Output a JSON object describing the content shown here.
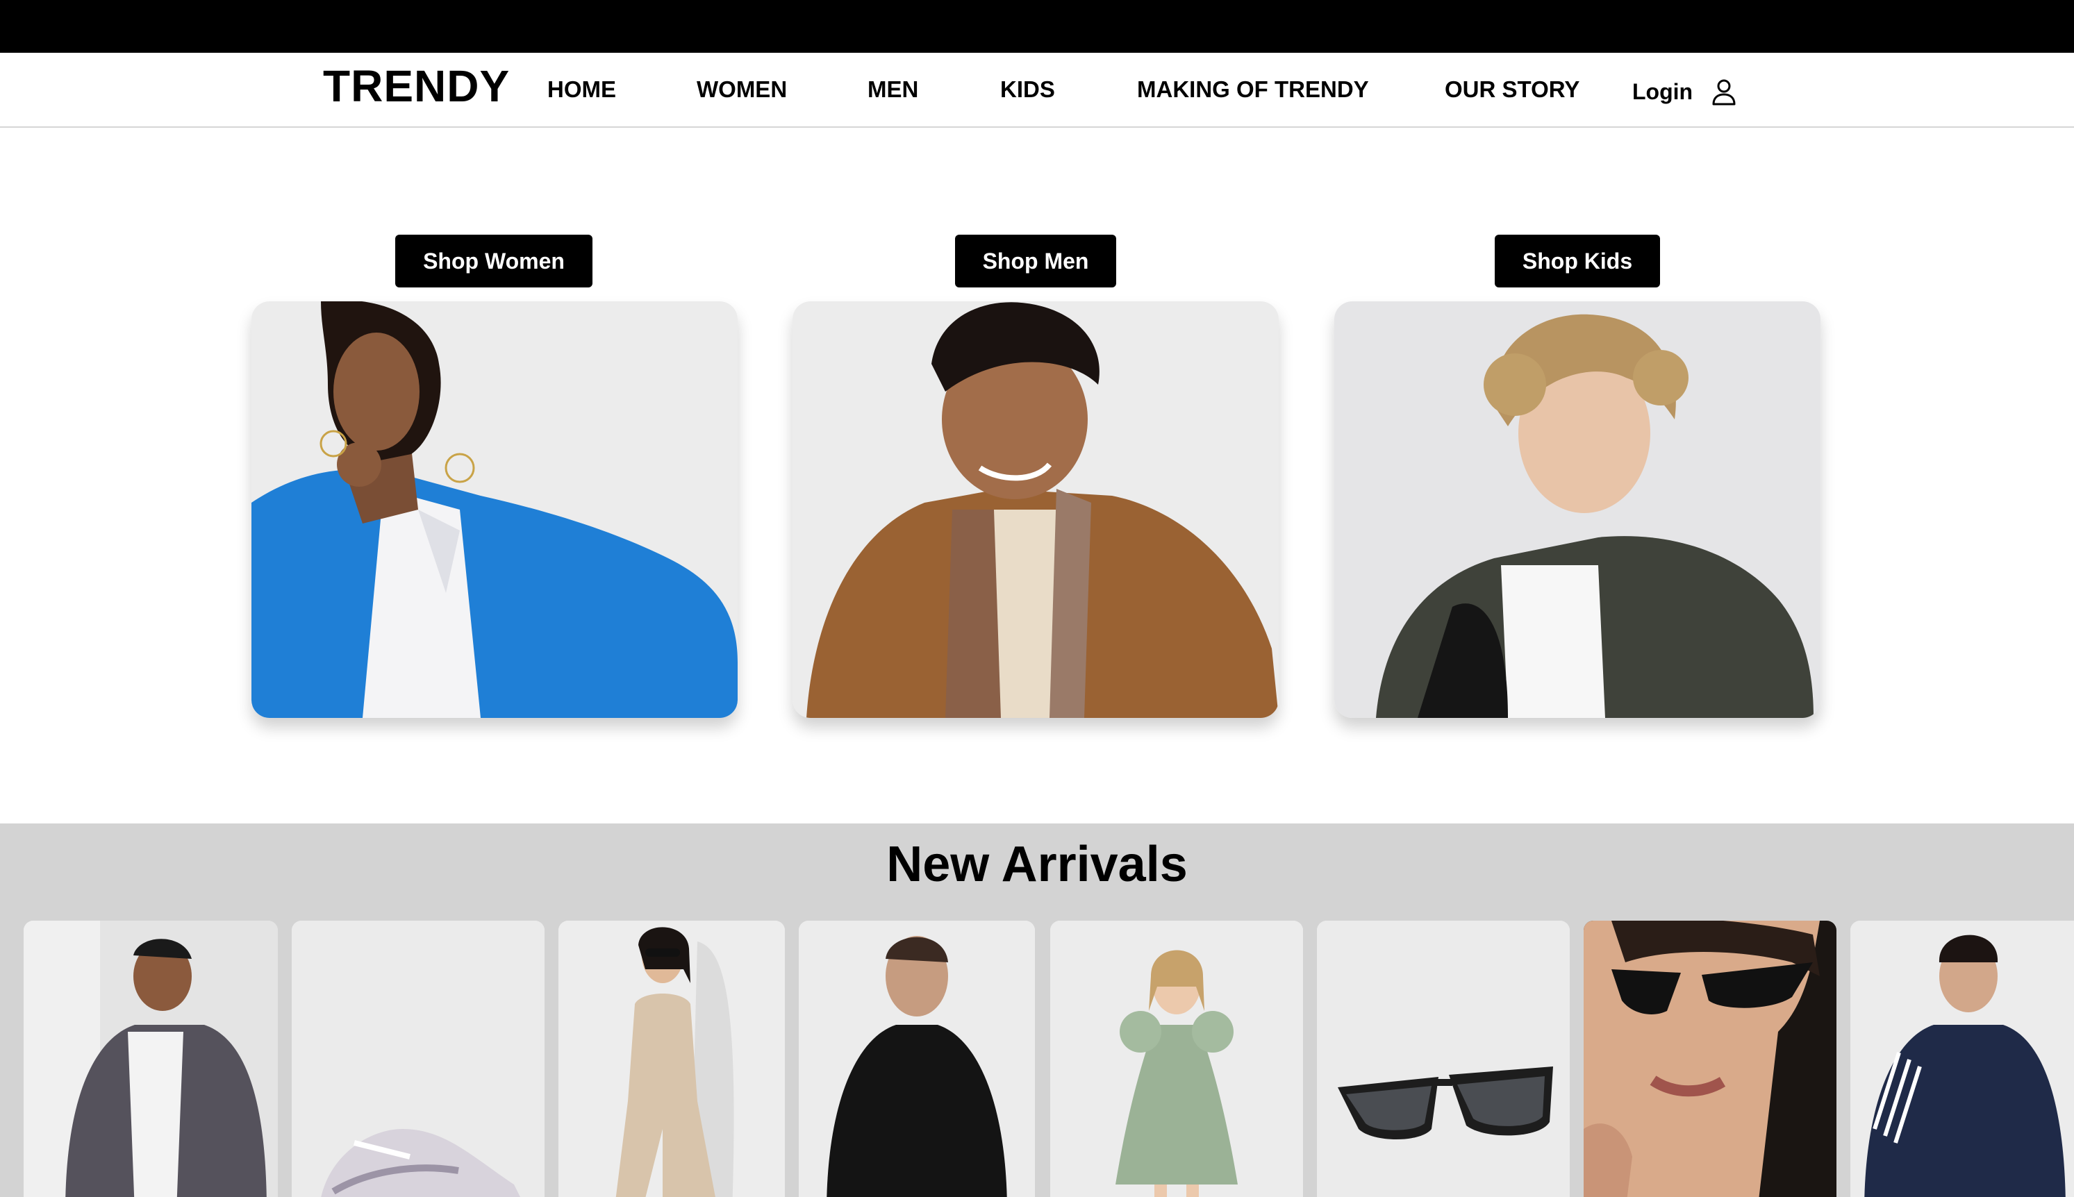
{
  "brand": {
    "logo": "TRENDY"
  },
  "nav": {
    "items": [
      {
        "label": "HOME"
      },
      {
        "label": "WOMEN"
      },
      {
        "label": "MEN"
      },
      {
        "label": "KIDS"
      },
      {
        "label": "MAKING OF TRENDY"
      },
      {
        "label": "OUR STORY"
      }
    ],
    "login_label": "Login",
    "login_icon": "user-icon"
  },
  "categories": [
    {
      "button_label": "Shop Women",
      "image": "woman-blue-coat-photo"
    },
    {
      "button_label": "Shop Men",
      "image": "man-brown-jacket-photo"
    },
    {
      "button_label": "Shop Kids",
      "image": "kid-puffer-jacket-photo"
    }
  ],
  "new_arrivals": {
    "title": "New Arrivals",
    "products": [
      {
        "image": "grey-zip-hoodie-photo"
      },
      {
        "image": "white-sneaker-photo"
      },
      {
        "image": "beige-jumpsuit-photo"
      },
      {
        "image": "black-jacket-photo"
      },
      {
        "image": "green-dress-photo"
      },
      {
        "image": "black-sunglasses-photo"
      },
      {
        "image": "cat-eye-sunglasses-photo"
      },
      {
        "image": "navy-track-jacket-photo"
      }
    ]
  },
  "colors": {
    "topbar": "#000000",
    "button": "#000000",
    "arrivals_bg": "#d3d3d3"
  }
}
